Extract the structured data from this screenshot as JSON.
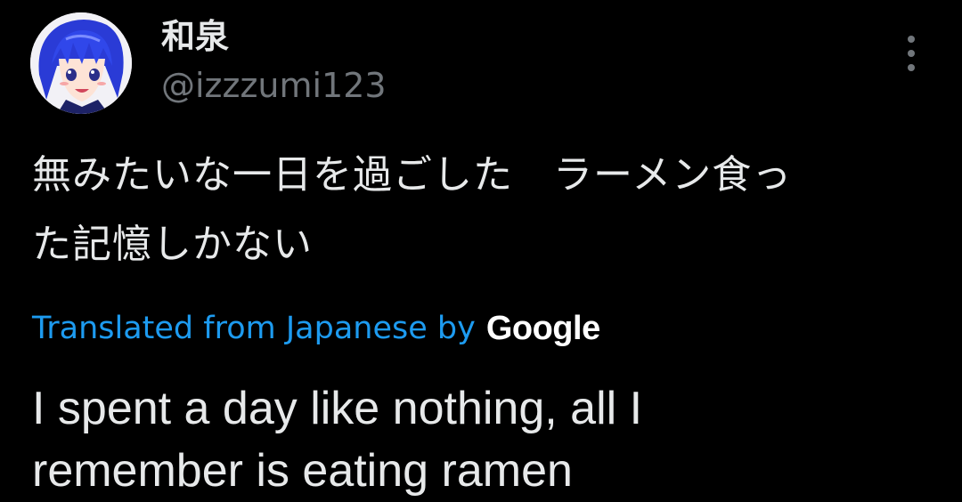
{
  "user": {
    "display_name": "和泉",
    "handle": "@izzzumi123",
    "avatar_icon": "anime-avatar-icon"
  },
  "menu": {
    "more_icon": "more-vertical-icon"
  },
  "tweet": {
    "original_lines": [
      "無みたいな一日を過ごした　ラーメン食っ",
      "た記憶しかない"
    ],
    "translated_label": "Translated from Japanese by",
    "translator_logo": "Google",
    "translation_lines": [
      "I spent a day like nothing, all I",
      "remember is eating ramen"
    ]
  },
  "colors": {
    "background": "#000000",
    "primary_text": "#e7e9ea",
    "secondary_text": "#71767b",
    "link": "#1d9bf0"
  }
}
